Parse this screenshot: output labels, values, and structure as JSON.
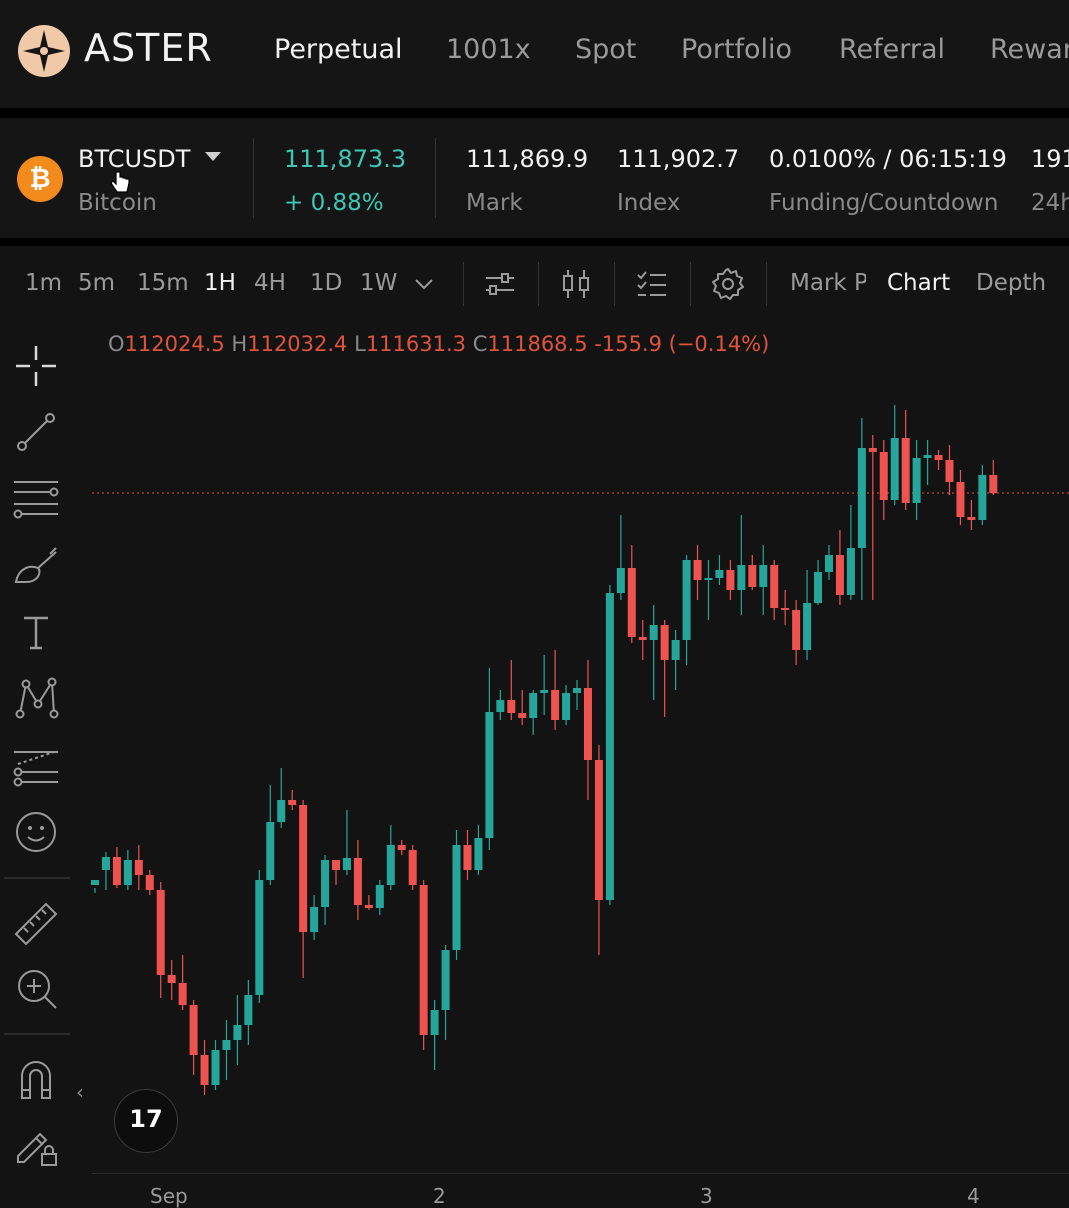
{
  "nav": {
    "brand": "ASTER",
    "items": [
      "Perpetual",
      "1001x",
      "Spot",
      "Portfolio",
      "Referral",
      "Rewar"
    ]
  },
  "ticker": {
    "symbol": "BTCUSDT",
    "name": "Bitcoin",
    "coin_glyph": "₿",
    "last_price": "111,873.3",
    "change": "+ 0.88%",
    "mark_price": "111,869.9",
    "mark_label": "Mark",
    "index_price": "111,902.7",
    "index_label": "Index",
    "funding": "0.0100% / 06:15:19",
    "funding_label": "Funding/Countdown",
    "vol_value": "191",
    "vol_label": "24h"
  },
  "timeframes": [
    "1m",
    "5m",
    "15m",
    "1H",
    "4H",
    "1D",
    "1W"
  ],
  "active_timeframe": "1H",
  "view_tabs": [
    "Mark P",
    "Chart",
    "Depth"
  ],
  "active_view": "Chart",
  "ohlc": {
    "o_label": "O",
    "o": "112024.5",
    "h_label": "H",
    "h": "112032.4",
    "l_label": "L",
    "l": "111631.3",
    "c_label": "C",
    "c": "111868.5",
    "chg": "-155.9 (−0.14%)"
  },
  "x_labels": [
    "Sep",
    "2",
    "3",
    "4"
  ],
  "tv_logo": "17",
  "colors": {
    "up": "#26a69a",
    "down": "#ef5350",
    "accent": "#f38a1c",
    "price_line": "#e0533d"
  },
  "icons": [
    "crosshair-icon",
    "trend-line-icon",
    "fib-lines-icon",
    "brush-icon",
    "text-icon",
    "pattern-icon",
    "forecast-icon",
    "emoji-icon",
    "ruler-icon",
    "zoom-in-icon",
    "magnet-icon",
    "lock-draw-icon",
    "bar-style-icon",
    "candles-icon",
    "indicators-icon",
    "settings-icon"
  ],
  "chart_data": {
    "type": "candlestick",
    "ohlc": [
      [
        885,
        880,
        888,
        893
      ],
      [
        870,
        857,
        852,
        890
      ],
      [
        857,
        885,
        847,
        888
      ],
      [
        885,
        860,
        850,
        890
      ],
      [
        860,
        875,
        845,
        890
      ],
      [
        875,
        890,
        870,
        895
      ],
      [
        890,
        975,
        882,
        998
      ],
      [
        975,
        983,
        960,
        1000
      ],
      [
        983,
        1005,
        955,
        1010
      ],
      [
        1005,
        1055,
        1000,
        1075
      ],
      [
        1055,
        1085,
        1040,
        1095
      ],
      [
        1085,
        1050,
        1040,
        1090
      ],
      [
        1050,
        1040,
        1020,
        1080
      ],
      [
        1040,
        1025,
        995,
        1065
      ],
      [
        1025,
        995,
        980,
        1045
      ],
      [
        995,
        880,
        870,
        1003
      ],
      [
        880,
        822,
        785,
        885
      ],
      [
        822,
        800,
        768,
        828
      ],
      [
        800,
        805,
        790,
        810
      ],
      [
        805,
        932,
        800,
        978
      ],
      [
        932,
        907,
        895,
        940
      ],
      [
        907,
        860,
        855,
        925
      ],
      [
        860,
        870,
        860,
        885
      ],
      [
        870,
        858,
        810,
        875
      ],
      [
        858,
        905,
        840,
        920
      ],
      [
        905,
        908,
        895,
        910
      ],
      [
        908,
        885,
        880,
        915
      ],
      [
        885,
        845,
        825,
        890
      ],
      [
        845,
        850,
        840,
        855
      ],
      [
        850,
        885,
        845,
        890
      ],
      [
        885,
        1035,
        880,
        1050
      ],
      [
        1035,
        1010,
        1000,
        1070
      ],
      [
        1010,
        950,
        945,
        1040
      ],
      [
        950,
        845,
        830,
        960
      ],
      [
        845,
        870,
        830,
        880
      ],
      [
        870,
        838,
        825,
        875
      ],
      [
        838,
        712,
        668,
        850
      ],
      [
        712,
        700,
        690,
        720
      ],
      [
        700,
        713,
        660,
        720
      ],
      [
        713,
        718,
        690,
        725
      ],
      [
        718,
        693,
        690,
        735
      ],
      [
        693,
        690,
        655,
        715
      ],
      [
        690,
        720,
        650,
        730
      ],
      [
        720,
        693,
        685,
        725
      ],
      [
        693,
        688,
        680,
        710
      ],
      [
        688,
        760,
        660,
        800
      ],
      [
        760,
        900,
        745,
        955
      ],
      [
        900,
        593,
        585,
        905
      ],
      [
        593,
        568,
        515,
        600
      ],
      [
        568,
        637,
        545,
        643
      ],
      [
        637,
        640,
        620,
        660
      ],
      [
        640,
        625,
        605,
        700
      ],
      [
        625,
        660,
        620,
        717
      ],
      [
        660,
        640,
        630,
        690
      ],
      [
        640,
        560,
        555,
        665
      ],
      [
        560,
        580,
        545,
        600
      ],
      [
        580,
        578,
        560,
        620
      ],
      [
        578,
        570,
        555,
        585
      ],
      [
        570,
        590,
        560,
        600
      ],
      [
        590,
        565,
        515,
        615
      ],
      [
        565,
        587,
        555,
        590
      ],
      [
        587,
        565,
        545,
        615
      ],
      [
        565,
        608,
        560,
        620
      ],
      [
        608,
        610,
        590,
        625
      ],
      [
        610,
        650,
        600,
        665
      ],
      [
        650,
        603,
        570,
        660
      ],
      [
        603,
        572,
        560,
        605
      ],
      [
        572,
        555,
        545,
        580
      ],
      [
        555,
        595,
        530,
        605
      ],
      [
        595,
        548,
        505,
        600
      ],
      [
        548,
        448,
        418,
        600
      ],
      [
        448,
        452,
        435,
        600
      ],
      [
        452,
        500,
        440,
        520
      ],
      [
        500,
        438,
        405,
        505
      ],
      [
        438,
        503,
        410,
        510
      ],
      [
        503,
        458,
        440,
        520
      ],
      [
        458,
        455,
        440,
        485
      ],
      [
        455,
        460,
        450,
        470
      ],
      [
        460,
        482,
        445,
        495
      ],
      [
        482,
        517,
        470,
        525
      ],
      [
        517,
        520,
        500,
        530
      ],
      [
        520,
        475,
        465,
        525
      ],
      [
        475,
        493,
        460,
        495
      ]
    ]
  }
}
